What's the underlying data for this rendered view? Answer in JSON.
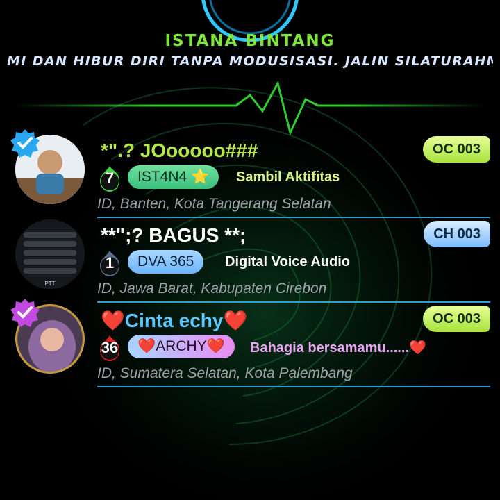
{
  "header": {
    "title": "ISTANA BINTANG",
    "marquee": "MI DAN HIBUR DIRI TANPA MODUSISASI. JALIN SILATURAHMI"
  },
  "rows": [
    {
      "name": "*\".? JOooooo###",
      "level": "7",
      "pill_label": "IST4N4 ⭐",
      "motto": "Sambil Aktifitas",
      "location": "ID, Banten, Kota Tangerang Selatan",
      "badge": "OC 003"
    },
    {
      "name": "**\";? BAGUS **;",
      "level": "1",
      "pill_label": "DVA 365",
      "motto": "Digital Voice Audio",
      "location": "ID, Jawa Barat, Kabupaten Cirebon",
      "badge": "CH 003"
    },
    {
      "name": "❤️Cinta echy❤️",
      "level": "36",
      "pill_label": "❤️ARCHY❤️",
      "motto": "Bahagia bersamamu......❤️",
      "location": "ID, Sumatera Selatan, Kota Palembang",
      "badge": "OC 003"
    }
  ],
  "colors": {
    "title": "#7ee83a",
    "divider": "#2f9ed6",
    "pulse": "#3bff3b",
    "name_row1": "#b6e84a",
    "name_row3": "#5cc8ff"
  },
  "icons": [
    "verified-badge-icon",
    "flame-level-icon"
  ]
}
